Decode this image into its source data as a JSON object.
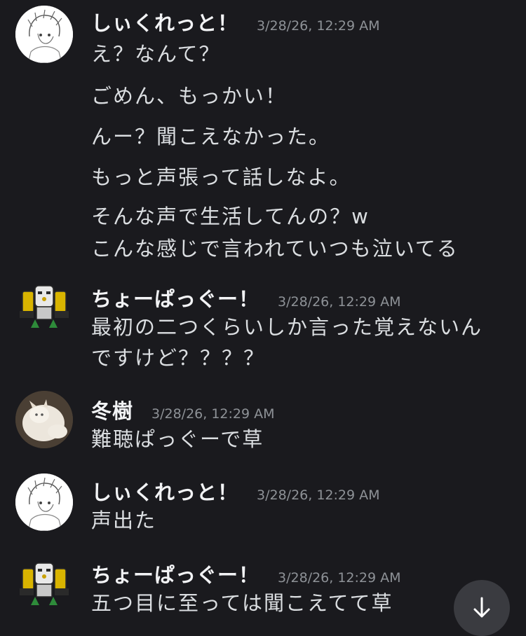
{
  "messages": [
    {
      "username": "しぃくれっと！",
      "timestamp": "3/28/26, 12:29 AM",
      "avatar": "sketch-character-avatar",
      "lines": [
        "え？なんて？",
        "ごめん、もっかい！",
        "んー？聞こえなかった。",
        "もっと声張って話しなよ。",
        "そんな声で生活してんの？w",
        "こんな感じで言われていつも泣いてる"
      ]
    },
    {
      "username": "ちょーぱっぐー！",
      "timestamp": "3/28/26, 12:29 AM",
      "avatar": "robot-creature-avatar",
      "lines": [
        "最初の二つくらいしか言った覚えないん",
        "ですけど？？？？"
      ]
    },
    {
      "username": "冬樹",
      "timestamp": "3/28/26, 12:29 AM",
      "avatar": "white-cat-avatar",
      "lines": [
        "難聴ぱっぐーで草"
      ]
    },
    {
      "username": "しぃくれっと！",
      "timestamp": "3/28/26, 12:29 AM",
      "avatar": "sketch-character-avatar",
      "lines": [
        "声出た"
      ]
    },
    {
      "username": "ちょーぱっぐー！",
      "timestamp": "3/28/26, 12:29 AM",
      "avatar": "robot-creature-avatar",
      "lines": [
        "五つ目に至っては聞こえてて草"
      ]
    }
  ],
  "scroll_button": {
    "icon": "arrow-down-icon"
  }
}
